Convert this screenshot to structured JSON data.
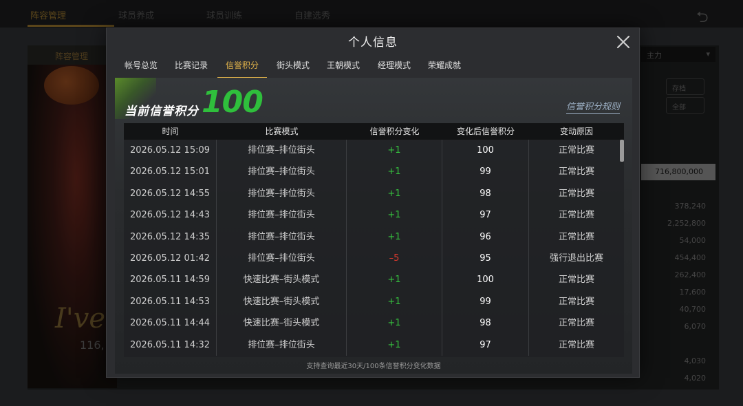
{
  "background": {
    "nav_tabs": [
      "阵容管理",
      "球员养成",
      "球员训练",
      "自建选秀"
    ],
    "sub_tab": "阵容管理",
    "select_value": "主力",
    "buttons": [
      "存档",
      "全部"
    ],
    "highlight_value": "716,800,000",
    "stats": [
      "378,240",
      "2,252,800",
      "54,000",
      "454,400",
      "262,400",
      "17,600",
      "40,700",
      "6,070",
      "4,030",
      "4,020"
    ],
    "signature": "I've l",
    "signature_sub": "116,"
  },
  "modal": {
    "title": "个人信息",
    "tabs": [
      "帐号总览",
      "比赛记录",
      "信誉积分",
      "街头模式",
      "王朝模式",
      "经理模式",
      "荣耀成就"
    ],
    "active_tab_index": 2,
    "score_label": "当前信誉积分",
    "score_value": "100",
    "rules_link": "信誉积分规则",
    "table": {
      "headers": [
        "时间",
        "比赛模式",
        "信誉积分变化",
        "变化后信誉积分",
        "变动原因"
      ],
      "rows": [
        {
          "time": "2026.05.12  15:09",
          "mode": "排位赛–排位街头",
          "change": "+1",
          "after": "100",
          "reason": "正常比赛"
        },
        {
          "time": "2026.05.12  15:01",
          "mode": "排位赛–排位街头",
          "change": "+1",
          "after": "99",
          "reason": "正常比赛"
        },
        {
          "time": "2026.05.12  14:55",
          "mode": "排位赛–排位街头",
          "change": "+1",
          "after": "98",
          "reason": "正常比赛"
        },
        {
          "time": "2026.05.12  14:43",
          "mode": "排位赛–排位街头",
          "change": "+1",
          "after": "97",
          "reason": "正常比赛"
        },
        {
          "time": "2026.05.12  14:35",
          "mode": "排位赛–排位街头",
          "change": "+1",
          "after": "96",
          "reason": "正常比赛"
        },
        {
          "time": "2026.05.12  01:42",
          "mode": "排位赛–排位街头",
          "change": "–5",
          "after": "95",
          "reason": "强行退出比赛"
        },
        {
          "time": "2026.05.11  14:59",
          "mode": "快速比赛–街头模式",
          "change": "+1",
          "after": "100",
          "reason": "正常比赛"
        },
        {
          "time": "2026.05.11  14:53",
          "mode": "快速比赛–街头模式",
          "change": "+1",
          "after": "99",
          "reason": "正常比赛"
        },
        {
          "time": "2026.05.11  14:44",
          "mode": "快速比赛–街头模式",
          "change": "+1",
          "after": "98",
          "reason": "正常比赛"
        },
        {
          "time": "2026.05.11  14:32",
          "mode": "排位赛–排位街头",
          "change": "+1",
          "after": "97",
          "reason": "正常比赛"
        }
      ]
    },
    "footer_note": "支持查询最近30天/100条信誉积分变化数据",
    "colors": {
      "accent": "#e0b24a",
      "positive": "#36c43f",
      "negative": "#d8392e",
      "score": "#2fbf3c"
    }
  }
}
